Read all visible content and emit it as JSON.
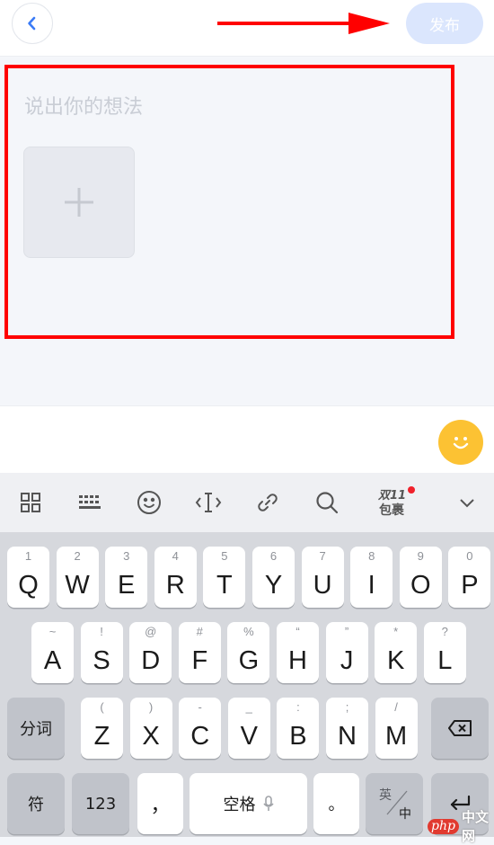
{
  "header": {
    "publish_label": "发布"
  },
  "editor": {
    "placeholder": "说出你的想法"
  },
  "toolbar": {
    "promo_line1": "双11",
    "promo_line2": "包裹"
  },
  "keyboard": {
    "row1": [
      {
        "main": "Q",
        "sup": "1"
      },
      {
        "main": "W",
        "sup": "2"
      },
      {
        "main": "E",
        "sup": "3"
      },
      {
        "main": "R",
        "sup": "4"
      },
      {
        "main": "T",
        "sup": "5"
      },
      {
        "main": "Y",
        "sup": "6"
      },
      {
        "main": "U",
        "sup": "7"
      },
      {
        "main": "I",
        "sup": "8"
      },
      {
        "main": "O",
        "sup": "9"
      },
      {
        "main": "P",
        "sup": "0"
      }
    ],
    "row2": [
      {
        "main": "A",
        "sup": "~"
      },
      {
        "main": "S",
        "sup": "!"
      },
      {
        "main": "D",
        "sup": "@"
      },
      {
        "main": "F",
        "sup": "#"
      },
      {
        "main": "G",
        "sup": "%"
      },
      {
        "main": "H",
        "sup": "“"
      },
      {
        "main": "J",
        "sup": "”"
      },
      {
        "main": "K",
        "sup": "*"
      },
      {
        "main": "L",
        "sup": "?"
      }
    ],
    "row3": [
      {
        "main": "Z",
        "sup": "("
      },
      {
        "main": "X",
        "sup": ")"
      },
      {
        "main": "C",
        "sup": "-"
      },
      {
        "main": "V",
        "sup": "_"
      },
      {
        "main": "B",
        "sup": ":"
      },
      {
        "main": "N",
        "sup": ";"
      },
      {
        "main": "M",
        "sup": "/"
      }
    ],
    "fenci_label": "分词",
    "symbol_label": "符",
    "num_label": "123",
    "comma_label": "，",
    "space_label": "空格",
    "period_label": "。",
    "lang_en": "英",
    "lang_zh": "中"
  },
  "watermark": {
    "logo": "php",
    "text": "中文网"
  }
}
